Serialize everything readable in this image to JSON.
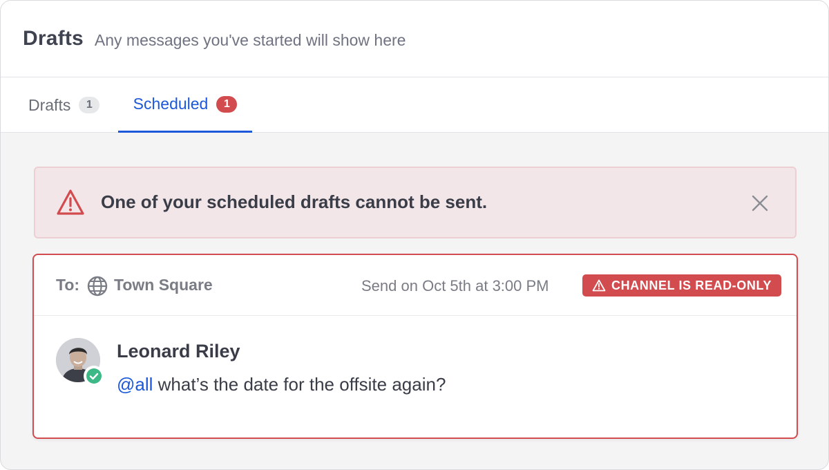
{
  "header": {
    "title": "Drafts",
    "subtitle": "Any messages you've started will show here"
  },
  "tabs": [
    {
      "label": "Drafts",
      "count": "1",
      "active": false
    },
    {
      "label": "Scheduled",
      "count": "1",
      "active": true
    }
  ],
  "alert": {
    "icon": "warning-triangle-icon",
    "text": "One of your scheduled drafts cannot be sent."
  },
  "draft": {
    "to_label": "To:",
    "channel_icon": "globe-icon",
    "channel": "Town Square",
    "send_on": "Send on Oct 5th at 3:00 PM",
    "status_badge": "CHANNEL IS READ-ONLY",
    "author": "Leonard Riley",
    "mention": "@all",
    "message": " what’s the date for the offsite again?"
  },
  "colors": {
    "accent": "#1c58d9",
    "danger": "#d24b4e",
    "online": "#3db887"
  }
}
